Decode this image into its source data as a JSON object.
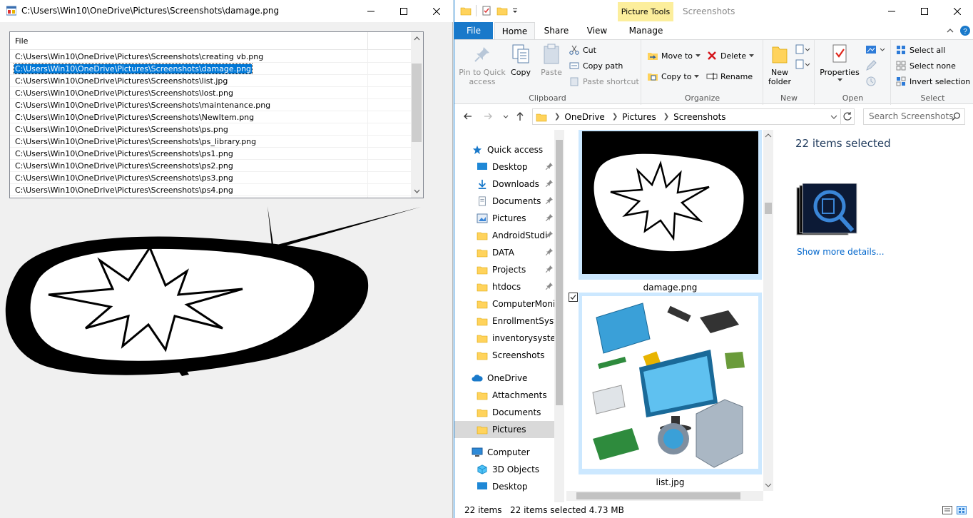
{
  "left_window": {
    "title": "C:\\Users\\Win10\\OneDrive\\Pictures\\Screenshots\\damage.png",
    "column_header": "File",
    "files": [
      "C:\\Users\\Win10\\OneDrive\\Pictures\\Screenshots\\creating vb.png",
      "C:\\Users\\Win10\\OneDrive\\Pictures\\Screenshots\\damage.png",
      "C:\\Users\\Win10\\OneDrive\\Pictures\\Screenshots\\list.jpg",
      "C:\\Users\\Win10\\OneDrive\\Pictures\\Screenshots\\lost.png",
      "C:\\Users\\Win10\\OneDrive\\Pictures\\Screenshots\\maintenance.png",
      "C:\\Users\\Win10\\OneDrive\\Pictures\\Screenshots\\NewItem.png",
      "C:\\Users\\Win10\\OneDrive\\Pictures\\Screenshots\\ps.png",
      "C:\\Users\\Win10\\OneDrive\\Pictures\\Screenshots\\ps_library.png",
      "C:\\Users\\Win10\\OneDrive\\Pictures\\Screenshots\\ps1.png",
      "C:\\Users\\Win10\\OneDrive\\Pictures\\Screenshots\\ps2.png",
      "C:\\Users\\Win10\\OneDrive\\Pictures\\Screenshots\\ps3.png",
      "C:\\Users\\Win10\\OneDrive\\Pictures\\Screenshots\\ps4.png"
    ],
    "selected_index": 1
  },
  "explorer": {
    "context_tab": "Picture Tools",
    "title": "Screenshots",
    "tabs": {
      "file": "File",
      "home": "Home",
      "share": "Share",
      "view": "View",
      "manage": "Manage"
    },
    "ribbon": {
      "clipboard": {
        "label": "Clipboard",
        "pin_line1": "Pin to Quick",
        "pin_line2": "access",
        "copy": "Copy",
        "paste": "Paste",
        "cut": "Cut",
        "copy_path": "Copy path",
        "paste_shortcut": "Paste shortcut"
      },
      "organize": {
        "label": "Organize",
        "move_to": "Move to",
        "copy_to": "Copy to",
        "delete": "Delete",
        "rename": "Rename"
      },
      "new": {
        "label": "New",
        "new_folder_line1": "New",
        "new_folder_line2": "folder"
      },
      "open": {
        "label": "Open",
        "properties": "Properties"
      },
      "select": {
        "label": "Select",
        "select_all": "Select all",
        "select_none": "Select none",
        "invert": "Invert selection"
      }
    },
    "address": {
      "crumbs": [
        "OneDrive",
        "Pictures",
        "Screenshots"
      ],
      "search_placeholder": "Search Screenshots"
    },
    "nav": {
      "quick_access": "Quick access",
      "items": [
        "Desktop",
        "Downloads",
        "Documents",
        "Pictures",
        "AndroidStudi",
        "DATA",
        "Projects",
        "htdocs",
        "ComputerMonit",
        "EnrollmentSyste",
        "inventorysystem",
        "Screenshots"
      ],
      "onedrive": "OneDrive",
      "onedrive_items": [
        "Attachments",
        "Documents",
        "Pictures"
      ],
      "computer": "Computer",
      "computer_items": [
        "3D Objects",
        "Desktop"
      ]
    },
    "thumbnails": [
      {
        "name": "damage.png"
      },
      {
        "name": "list.jpg"
      }
    ],
    "details": {
      "title": "22 items selected",
      "more": "Show more details..."
    },
    "status": {
      "count": "22 items",
      "selected": "22 items selected  4.73 MB"
    }
  }
}
